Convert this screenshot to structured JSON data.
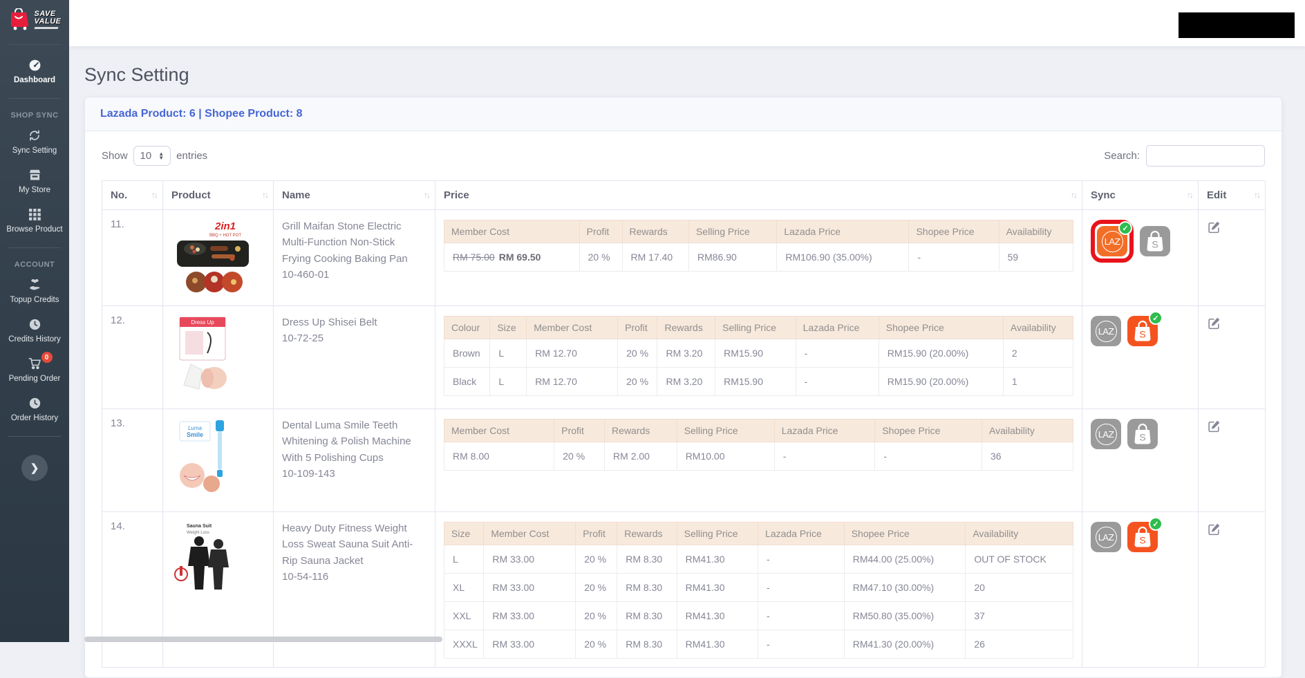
{
  "colors": {
    "accent_blue": "#4566d4",
    "lazada_orange": "#f26e27",
    "shopee_orange": "#f4531f",
    "inactive_gray": "#9a9a9a",
    "check_green": "#2ebd4e",
    "highlight_red": "#e8131b",
    "badge_red": "#e74a3b",
    "price_header_bg": "#f8e9dd",
    "redaction": "#000000"
  },
  "sidebar": {
    "brand": {
      "line1": "SAVE",
      "line2": "VALUE"
    },
    "sections": {
      "shop_sync": "SHOP SYNC",
      "account": "ACCOUNT"
    },
    "items": [
      {
        "id": "dashboard",
        "label": "Dashboard",
        "icon": "dashboard-icon"
      },
      {
        "id": "sync-setting",
        "label": "Sync Setting",
        "icon": "sync-icon"
      },
      {
        "id": "my-store",
        "label": "My Store",
        "icon": "store-icon"
      },
      {
        "id": "browse-product",
        "label": "Browse Product",
        "icon": "grid-icon"
      },
      {
        "id": "topup-credits",
        "label": "Topup Credits",
        "icon": "hand-heart-icon"
      },
      {
        "id": "credits-history",
        "label": "Credits History",
        "icon": "history-icon"
      },
      {
        "id": "pending-order",
        "label": "Pending Order",
        "icon": "cart-icon",
        "badge": "0"
      },
      {
        "id": "order-history",
        "label": "Order History",
        "icon": "history-icon"
      }
    ],
    "collapse_chevron": "❯"
  },
  "page": {
    "title": "Sync Setting"
  },
  "card": {
    "header": "Lazada Product: 6 | Shopee Product: 8"
  },
  "controls": {
    "show_label": "Show",
    "page_size": "10",
    "entries_label": "entries",
    "search_label": "Search:",
    "search_value": ""
  },
  "table": {
    "columns": [
      "No.",
      "Product",
      "Name",
      "Price",
      "Sync",
      "Edit"
    ],
    "sort_glyph": "↑↓"
  },
  "rows": [
    {
      "no": "11.",
      "name": "Grill Maifan Stone Electric Multi-Function Non-Stick Frying Cooking Baking Pan",
      "code": "10-460-01",
      "price": {
        "headers": [
          "Member Cost",
          "Profit",
          "Rewards",
          "Selling Price",
          "Lazada Price",
          "Shopee Price",
          "Availability"
        ],
        "member_cost_old": "RM 75.00",
        "member_cost_new": "RM 69.50",
        "values": [
          "20 %",
          "RM 17.40",
          "RM86.90",
          "RM106.90 (35.00%)",
          "-",
          "59"
        ]
      },
      "sync": {
        "lazada_active": true,
        "lazada_highlighted": true,
        "shopee_active": false
      }
    },
    {
      "no": "12.",
      "name": "Dress Up Shisei Belt",
      "code": "10-72-25",
      "price": {
        "headers": [
          "Colour",
          "Size",
          "Member Cost",
          "Profit",
          "Rewards",
          "Selling Price",
          "Lazada Price",
          "Shopee Price",
          "Availability"
        ],
        "rows": [
          [
            "Brown",
            "L",
            "RM 12.70",
            "20 %",
            "RM 3.20",
            "RM15.90",
            "-",
            "RM15.90 (20.00%)",
            "2"
          ],
          [
            "Black",
            "L",
            "RM 12.70",
            "20 %",
            "RM 3.20",
            "RM15.90",
            "-",
            "RM15.90 (20.00%)",
            "1"
          ]
        ]
      },
      "sync": {
        "lazada_active": false,
        "lazada_highlighted": false,
        "shopee_active": true
      }
    },
    {
      "no": "13.",
      "name": "Dental Luma Smile Teeth Whitening & Polish Machine With 5 Polishing Cups",
      "code": "10-109-143",
      "price": {
        "headers": [
          "Member Cost",
          "Profit",
          "Rewards",
          "Selling Price",
          "Lazada Price",
          "Shopee Price",
          "Availability"
        ],
        "rows": [
          [
            "RM 8.00",
            "20 %",
            "RM 2.00",
            "RM10.00",
            "-",
            "-",
            "36"
          ]
        ]
      },
      "sync": {
        "lazada_active": false,
        "lazada_highlighted": false,
        "shopee_active": false
      }
    },
    {
      "no": "14.",
      "name": "Heavy Duty Fitness Weight Loss Sweat Sauna Suit Anti-Rip Sauna Jacket",
      "code": "10-54-116",
      "price": {
        "headers": [
          "Size",
          "Member Cost",
          "Profit",
          "Rewards",
          "Selling Price",
          "Lazada Price",
          "Shopee Price",
          "Availability"
        ],
        "rows": [
          [
            "L",
            "RM 33.00",
            "20 %",
            "RM 8.30",
            "RM41.30",
            "-",
            "RM44.00 (25.00%)",
            "OUT OF STOCK"
          ],
          [
            "XL",
            "RM 33.00",
            "20 %",
            "RM 8.30",
            "RM41.30",
            "-",
            "RM47.10 (30.00%)",
            "20"
          ],
          [
            "XXL",
            "RM 33.00",
            "20 %",
            "RM 8.30",
            "RM41.30",
            "-",
            "RM50.80 (35.00%)",
            "37"
          ],
          [
            "XXXL",
            "RM 33.00",
            "20 %",
            "RM 8.30",
            "RM41.30",
            "-",
            "RM41.30 (20.00%)",
            "26"
          ]
        ]
      },
      "sync": {
        "lazada_active": false,
        "lazada_highlighted": false,
        "shopee_active": true
      }
    }
  ],
  "icons": {
    "lazada_label": "LAZ",
    "shopee_letter": "S",
    "check": "✓"
  }
}
